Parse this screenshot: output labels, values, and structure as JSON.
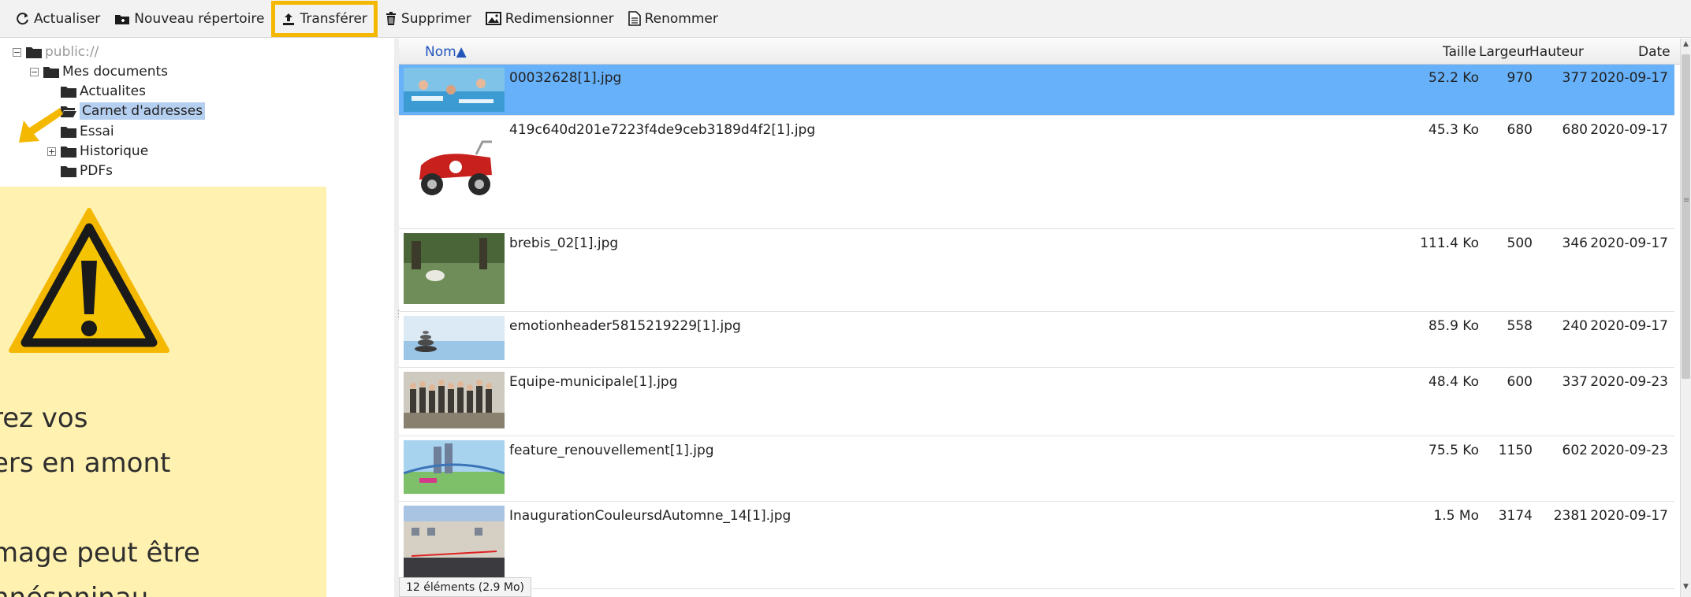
{
  "toolbar": {
    "refresh": "Actualiser",
    "new_folder": "Nouveau répertoire",
    "upload": "Transférer",
    "delete": "Supprimer",
    "resize": "Redimensionner",
    "rename": "Renommer"
  },
  "tree": {
    "root": "public://",
    "mes_documents": "Mes documents",
    "actualites": "Actualites",
    "carnet": "Carnet d'adresses",
    "essai": "Essai",
    "historique": "Historique",
    "pdfs": "PDFs"
  },
  "overlay": {
    "text": "rez vos\ners en amont\n\nmage peut être\nnnéspninau",
    "accent_color": "#f5b800"
  },
  "header": {
    "name": "Nom▲",
    "size": "Taille",
    "width": "Largeur",
    "height": "Hauteur",
    "date": "Date"
  },
  "files": [
    {
      "name": "00032628[1].jpg",
      "size": "52.2 Ko",
      "width": "970",
      "height": "377",
      "date": "2020-09-17"
    },
    {
      "name": "419c640d201e7223f4de9ceb3189d4f2[1].jpg",
      "size": "45.3 Ko",
      "width": "680",
      "height": "680",
      "date": "2020-09-17"
    },
    {
      "name": "brebis_02[1].jpg",
      "size": "111.4 Ko",
      "width": "500",
      "height": "346",
      "date": "2020-09-17"
    },
    {
      "name": "emotionheader5815219229[1].jpg",
      "size": "85.9 Ko",
      "width": "558",
      "height": "240",
      "date": "2020-09-17"
    },
    {
      "name": "Equipe-municipale[1].jpg",
      "size": "48.4 Ko",
      "width": "600",
      "height": "337",
      "date": "2020-09-23"
    },
    {
      "name": "feature_renouvellement[1].jpg",
      "size": "75.5 Ko",
      "width": "1150",
      "height": "602",
      "date": "2020-09-23"
    },
    {
      "name": "InaugurationCouleursdAutomne_14[1].jpg",
      "size": "1.5 Mo",
      "width": "3174",
      "height": "2381",
      "date": "2020-09-17"
    }
  ],
  "status": "12 éléments (2.9 Mo)",
  "colors": {
    "selected_row": "#66b1f9",
    "selected_folder": "#b5cff0",
    "highlight": "#f5b800",
    "overlay_bg": "#fff1b0"
  }
}
